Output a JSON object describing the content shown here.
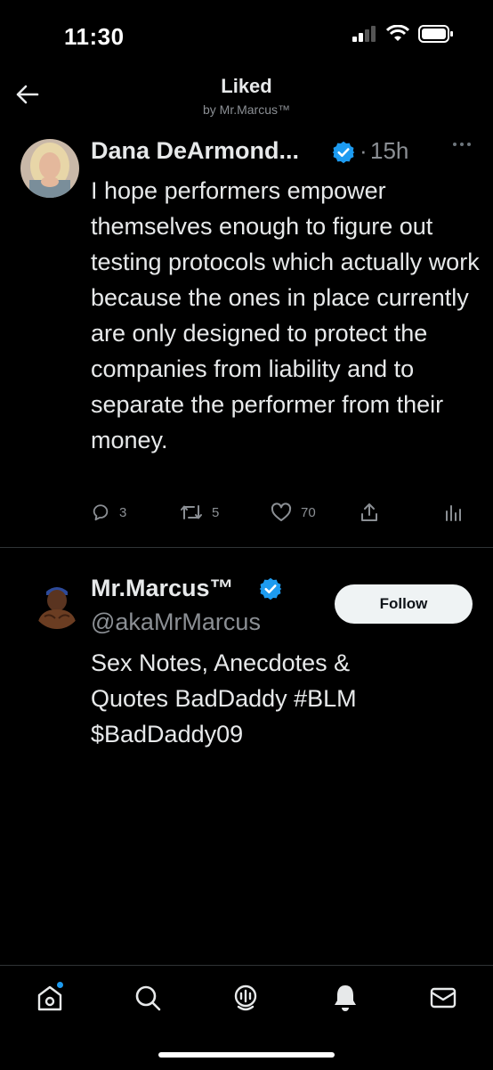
{
  "status_bar": {
    "time": "11:30"
  },
  "header": {
    "title": "Liked",
    "subtitle": "by Mr.Marcus™"
  },
  "tweet": {
    "author_name": "Dana DeArmond...",
    "dot": "·",
    "time": "15h",
    "text": "I hope performers empower themselves enough to figure out testing protocols which actually work because the ones in place currently are only designed to protect the companies from liability and to separate the performer from their money.",
    "replies": "3",
    "retweets": "5",
    "likes": "70"
  },
  "profile": {
    "name": "Mr.Marcus™",
    "handle": "@akaMrMarcus",
    "follow_label": "Follow",
    "bio_lines": [
      "Sex Notes, Anecdotes &",
      "Quotes BadDaddy #BLM",
      "$BadDaddy09"
    ]
  },
  "colors": {
    "accent": "#1d9bf0",
    "background": "#000000",
    "muted": "#8b8f94"
  },
  "icons": [
    "back-arrow-icon",
    "verified-icon",
    "more-icon",
    "reply-icon",
    "retweet-icon",
    "like-icon",
    "share-icon",
    "analytics-icon",
    "home-icon",
    "search-icon",
    "spaces-icon",
    "notifications-icon",
    "messages-icon"
  ]
}
